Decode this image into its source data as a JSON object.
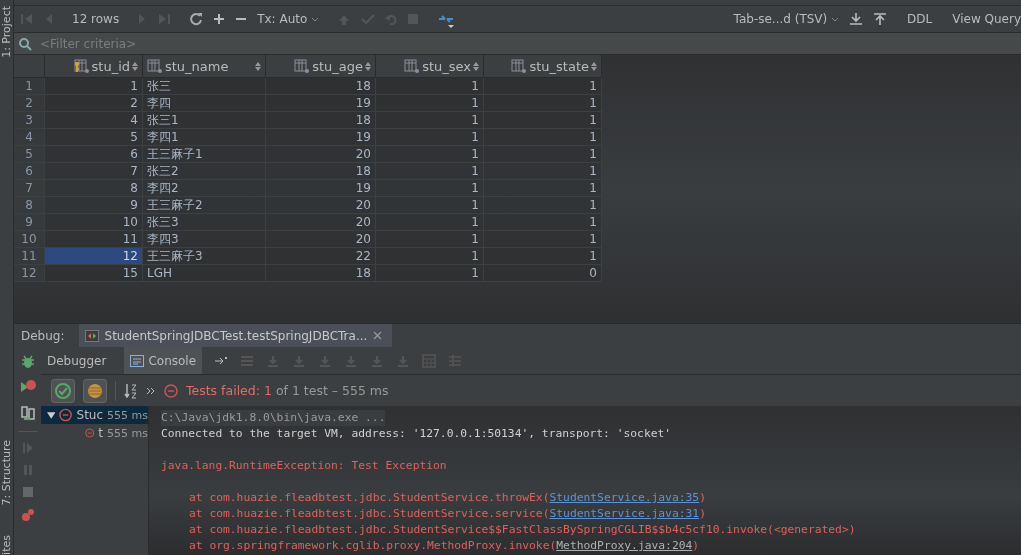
{
  "side_strip": {
    "tabs": [
      {
        "label": "1: Project"
      },
      {
        "label": "7: Structure"
      },
      {
        "label": "ites"
      }
    ]
  },
  "grid_toolbar": {
    "row_count": "12 rows",
    "transaction": "Tx: Auto",
    "format": "Tab-se...d (TSV)",
    "buttons": [
      "DDL",
      "View Query"
    ]
  },
  "filter": {
    "placeholder": "<Filter criteria>"
  },
  "table": {
    "columns": [
      {
        "name": "stu_id",
        "key": true,
        "kind": "number"
      },
      {
        "name": "stu_name",
        "key": false,
        "kind": "text"
      },
      {
        "name": "stu_age",
        "key": false,
        "kind": "number"
      },
      {
        "name": "stu_sex",
        "key": false,
        "kind": "number"
      },
      {
        "name": "stu_state",
        "key": false,
        "kind": "number"
      }
    ],
    "rows": [
      {
        "number": "1",
        "cells": [
          "1",
          "张三",
          "18",
          "1",
          "1"
        ],
        "selected": false
      },
      {
        "number": "2",
        "cells": [
          "2",
          "李四",
          "19",
          "1",
          "1"
        ],
        "selected": false
      },
      {
        "number": "3",
        "cells": [
          "4",
          "张三1",
          "18",
          "1",
          "1"
        ],
        "selected": false
      },
      {
        "number": "4",
        "cells": [
          "5",
          "李四1",
          "19",
          "1",
          "1"
        ],
        "selected": false
      },
      {
        "number": "5",
        "cells": [
          "6",
          "王三麻子1",
          "20",
          "1",
          "1"
        ],
        "selected": false
      },
      {
        "number": "6",
        "cells": [
          "7",
          "张三2",
          "18",
          "1",
          "1"
        ],
        "selected": false
      },
      {
        "number": "7",
        "cells": [
          "8",
          "李四2",
          "19",
          "1",
          "1"
        ],
        "selected": false
      },
      {
        "number": "8",
        "cells": [
          "9",
          "王三麻子2",
          "20",
          "1",
          "1"
        ],
        "selected": false
      },
      {
        "number": "9",
        "cells": [
          "10",
          "张三3",
          "20",
          "1",
          "1"
        ],
        "selected": false
      },
      {
        "number": "10",
        "cells": [
          "11",
          "李四3",
          "20",
          "1",
          "1"
        ],
        "selected": false
      },
      {
        "number": "11",
        "cells": [
          "12",
          "王三麻子3",
          "22",
          "1",
          "1"
        ],
        "selected": true
      },
      {
        "number": "12",
        "cells": [
          "15",
          "LGH",
          "18",
          "1",
          "0"
        ],
        "selected": false
      }
    ]
  },
  "debug": {
    "label": "Debug:",
    "session_tab": "StudentSpringJDBCTest.testSpringJDBCTra...",
    "tabs": [
      {
        "label": "Debugger",
        "selected": false
      },
      {
        "label": "Console",
        "selected": true
      }
    ],
    "status": {
      "failed": "Tests failed: 1",
      "rest": "of 1 test – 555 ms"
    },
    "tree": [
      {
        "label": "Stuc",
        "time": "555 ms",
        "expanded": true,
        "selected": true,
        "children": [
          {
            "label": "t",
            "time": "555 ms",
            "selected": false
          }
        ]
      }
    ],
    "console": [
      {
        "kind": "command",
        "text": "C:\\Java\\jdk1.8.0\\bin\\java.exe ..."
      },
      {
        "kind": "info",
        "text": "Connected to the target VM, address: '127.0.0.1:50134', transport: 'socket'"
      },
      {
        "kind": "blank"
      },
      {
        "kind": "error",
        "text": "java.lang.RuntimeException: Test Exception"
      },
      {
        "kind": "blank"
      },
      {
        "kind": "trace",
        "text": "at com.huazie.fleadbtest.jdbc.StudentService.throwEx(",
        "link": "StudentService.java:35",
        "end": ")"
      },
      {
        "kind": "trace",
        "text": "at com.huazie.fleadbtest.jdbc.StudentService.service(",
        "link": "StudentService.java:31",
        "end": ")"
      },
      {
        "kind": "trace",
        "text": "at com.huazie.fleadbtest.jdbc.StudentService$$FastClassBySpringCGLIB$$b4c5cf10.invoke(<generated>)"
      },
      {
        "kind": "trace_grey",
        "text": "at org.springframework.cglib.proxy.MethodProxy.invoke(",
        "link": "MethodProxy.java:204",
        "end": ")"
      }
    ]
  }
}
